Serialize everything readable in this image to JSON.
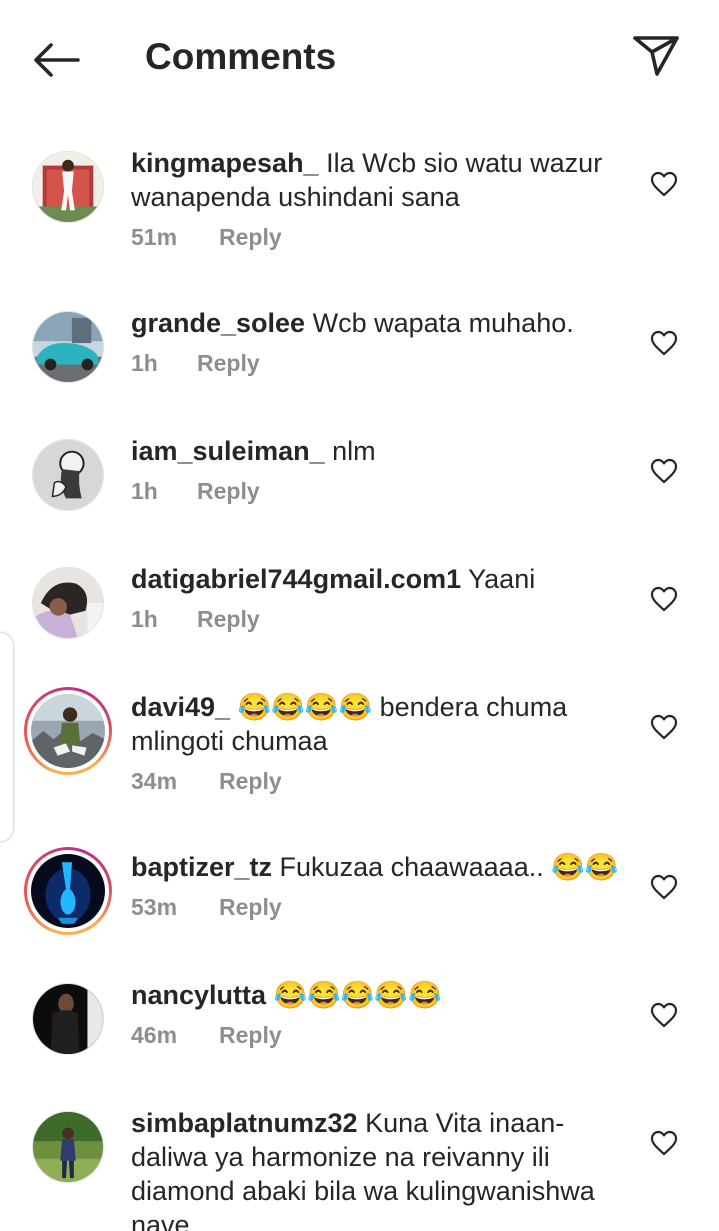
{
  "header": {
    "title": "Comments",
    "back_icon": "arrow-left-icon",
    "send_icon": "paper-plane-icon"
  },
  "comments": [
    {
      "username": "kingmapesah_",
      "text": "Ila Wcb sio watu wazur wanapenda ushindani sana",
      "time": "51m",
      "reply": "Reply",
      "story_ring": false
    },
    {
      "username": "grande_solee",
      "text": "Wcb wapata muhaho.",
      "time": "1h",
      "reply": "Reply",
      "story_ring": false
    },
    {
      "username": "iam_suleiman_",
      "text": "nlm",
      "time": "1h",
      "reply": "Reply",
      "story_ring": false
    },
    {
      "username": "datigabriel744gmail.com1",
      "text": "Yaani",
      "time": "1h",
      "reply": "Reply",
      "story_ring": false
    },
    {
      "username": "davi49_",
      "text": "😂😂😂😂 bendera chuma mlingoti chumaa",
      "time": "34m",
      "reply": "Reply",
      "story_ring": true
    },
    {
      "username": "baptizer_tz",
      "text": "Fukuzaa chaawaaaa.. 😂😂",
      "time": "53m",
      "reply": "Reply",
      "story_ring": true
    },
    {
      "username": "nancylutta",
      "text": "😂😂😂😂😂",
      "time": "46m",
      "reply": "Reply",
      "story_ring": false
    },
    {
      "username": "simbaplatnumz32",
      "text": "Kuna Vita inaan-daliwa ya harmonize na reivanny ili diamond abaki bila wa kulingwanishwa nave",
      "time": "",
      "reply": "",
      "story_ring": false
    }
  ],
  "colors": {
    "text": "#262626",
    "secondary": "#8e8e8e",
    "story_ring_start": "#fbad50",
    "story_ring_end": "#bc2a8d"
  }
}
